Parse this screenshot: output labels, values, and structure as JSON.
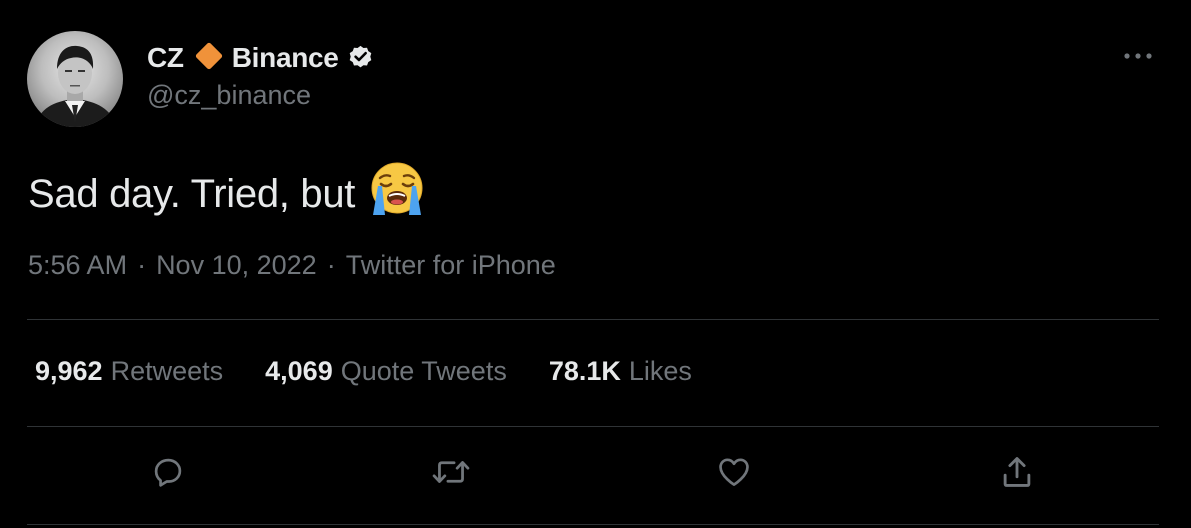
{
  "author": {
    "display_name_prefix": "CZ",
    "display_name_suffix": "Binance",
    "handle": "@cz_binance"
  },
  "tweet": {
    "text": "Sad day. Tried, but",
    "emoji": "loudly-crying-face",
    "time": "5:56 AM",
    "date": "Nov 10, 2022",
    "source": "Twitter for iPhone",
    "separator": "·"
  },
  "stats": {
    "retweets": {
      "count": "9,962",
      "label": "Retweets"
    },
    "quote_tweets": {
      "count": "4,069",
      "label": "Quote Tweets"
    },
    "likes": {
      "count": "78.1K",
      "label": "Likes"
    }
  },
  "icons": {
    "diamond": "orange-diamond-icon",
    "verified": "verified-badge-icon",
    "more": "more-options-icon",
    "reply": "reply-icon",
    "retweet": "retweet-icon",
    "like": "heart-icon",
    "share": "share-icon"
  },
  "colors": {
    "background": "#000000",
    "text_primary": "#e7e9ea",
    "text_secondary": "#71767b",
    "divider": "#2f3336",
    "diamond": "#f0923a"
  }
}
